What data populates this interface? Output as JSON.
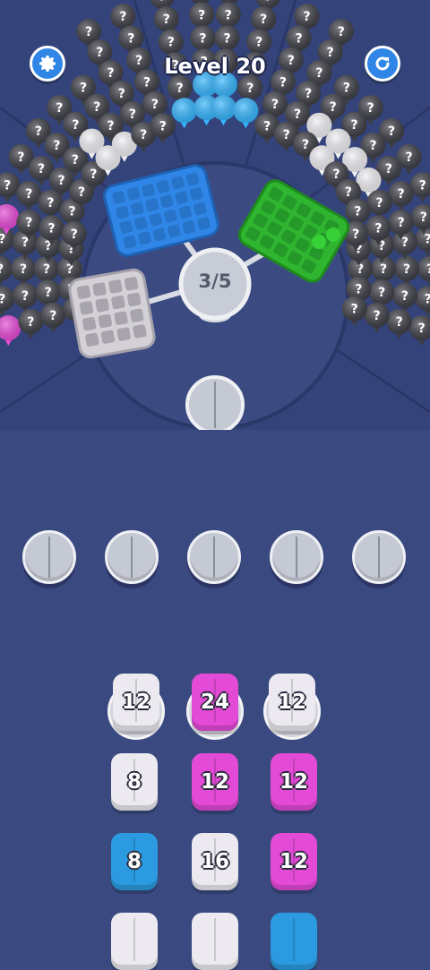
{
  "hud": {
    "level_title": "Level 20",
    "settings_icon": "gear-icon",
    "restart_icon": "restart-icon"
  },
  "hub": {
    "progress_label": "3/5"
  },
  "colors": {
    "background": "#3a4a80",
    "white_balls": "#f2f2f5",
    "magenta_balls": "#e84ad8",
    "blue_balls": "#35b6ff",
    "hidden_balls": "#3d3d46",
    "crate_blue": "#2f86e6",
    "crate_green": "#2fb52f",
    "crate_gray": "#d3d0d6"
  },
  "crates": [
    {
      "color": "blue"
    },
    {
      "color": "green"
    },
    {
      "color": "gray"
    }
  ],
  "queue": {
    "columns": [
      [
        "12",
        "8",
        "8"
      ],
      [
        "24",
        "12",
        "16"
      ],
      [
        "12",
        "12",
        "12"
      ]
    ],
    "column_colors": [
      [
        "white",
        "white",
        "blue"
      ],
      [
        "magenta",
        "magenta",
        "white"
      ],
      [
        "white",
        "magenta",
        "magenta"
      ]
    ]
  }
}
